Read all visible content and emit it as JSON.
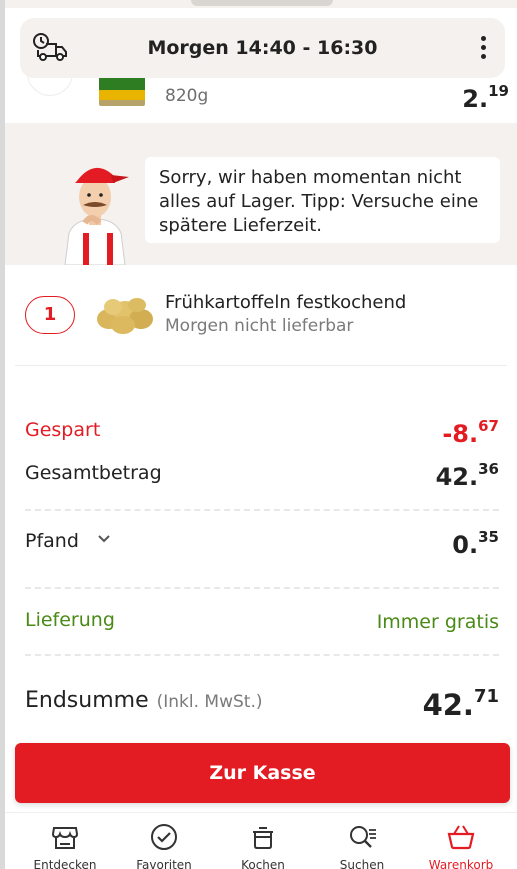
{
  "delivery_slot": {
    "time": "Morgen 14:40 - 16:30",
    "icon": "delivery-truck-clock-icon",
    "menu_icon": "more-vertical-icon"
  },
  "previous_item": {
    "weight": "820g",
    "price_main": "2.",
    "price_cents": "19"
  },
  "notice": {
    "message": "Sorry, wir haben momentan nicht alles auf Lager. Tipp: Versuche eine spätere Lieferzeit."
  },
  "unavailable_item": {
    "quantity": "1",
    "name": "Frühkartoffeln festkochend",
    "status": "Morgen nicht lieferbar"
  },
  "totals": {
    "saved_label": "Gespart",
    "saved_main": "-8.",
    "saved_cents": "67",
    "total_label": "Gesamtbetrag",
    "total_main": "42.",
    "total_cents": "36",
    "deposit_label": "Pfand",
    "deposit_main": "0.",
    "deposit_cents": "35",
    "delivery_label": "Lieferung",
    "delivery_value": "Immer gratis",
    "final_label": "Endsumme",
    "final_note": "(Inkl. MwSt.)",
    "final_main": "42.",
    "final_cents": "71"
  },
  "checkout": {
    "label": "Zur Kasse"
  },
  "nav": {
    "items": [
      {
        "label": "Entdecken",
        "icon": "store-icon"
      },
      {
        "label": "Favoriten",
        "icon": "check-circle-icon"
      },
      {
        "label": "Kochen",
        "icon": "cooking-pot-icon"
      },
      {
        "label": "Suchen",
        "icon": "search-list-icon"
      },
      {
        "label": "Warenkorb",
        "icon": "basket-icon"
      }
    ],
    "active": "Warenkorb"
  },
  "colors": {
    "accent": "#e31b23",
    "green": "#4a8a16",
    "banner_bg": "#f4f1ee"
  }
}
